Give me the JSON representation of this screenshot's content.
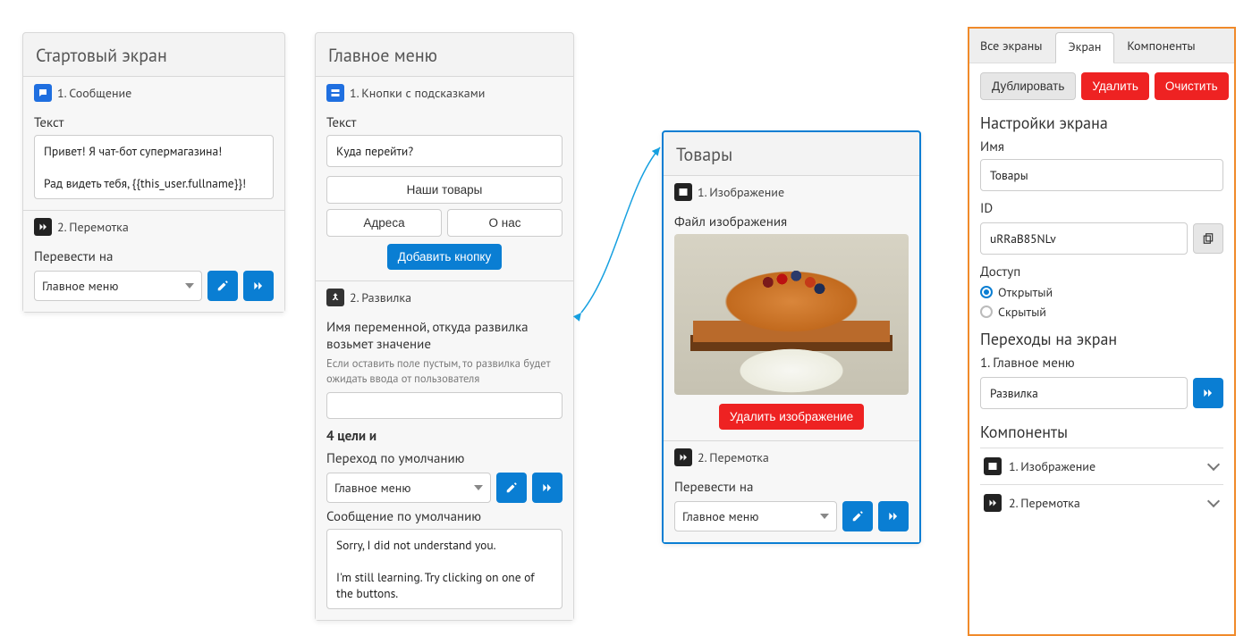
{
  "cards": {
    "start": {
      "title": "Стартовый экран",
      "msg": {
        "head": "1. Сообщение",
        "label": "Текст",
        "text": "Привет! Я чат-бот супермагазина!\n\nРад видеть тебя, {{this_user.fullname}}!"
      },
      "fwd": {
        "head": "2. Перемотка",
        "label": "Перевести на",
        "value": "Главное меню"
      }
    },
    "menu": {
      "title": "Главное меню",
      "btns": {
        "head": "1. Кнопки с подсказками",
        "label": "Текст",
        "text": "Куда перейти?",
        "b1": "Наши товары",
        "b2": "Адреса",
        "b3": "О нас",
        "add": "Добавить кнопку"
      },
      "fork": {
        "head": "2. Развилка",
        "varLabel": "Имя переменной, откуда развилка возьмет значение",
        "varHint": "Если оставить поле пустым, то развилка будет ожидать ввода от пользователя",
        "targets": "4 цели и",
        "defGoLabel": "Переход по умолчанию",
        "defGoValue": "Главное меню",
        "defMsgLabel": "Сообщение по умолчанию",
        "defMsgText": "Sorry, I did not understand you.\n\nI'm still learning. Try clicking on one of the buttons."
      }
    },
    "goods": {
      "title": "Товары",
      "img": {
        "head": "1. Изображение",
        "label": "Файл изображения",
        "del": "Удалить изображение"
      },
      "fwd": {
        "head": "2. Перемотка",
        "label": "Перевести на",
        "value": "Главное меню"
      }
    }
  },
  "panel": {
    "tabs": {
      "all": "Все экраны",
      "screen": "Экран",
      "comp": "Компоненты"
    },
    "actions": {
      "dup": "Дублировать",
      "del": "Удалить",
      "clear": "Очистить"
    },
    "settingsTitle": "Настройки экрана",
    "nameLabel": "Имя",
    "nameValue": "Товары",
    "idLabel": "ID",
    "idValue": "uRRaB85NLv",
    "accessLabel": "Доступ",
    "accessOpen": "Открытый",
    "accessHidden": "Скрытый",
    "navTitle": "Переходы на экран",
    "navFrom": "1. Главное меню",
    "navVia": "Развилка",
    "compTitle": "Компоненты",
    "comp1": "1. Изображение",
    "comp2": "2. Перемотка"
  }
}
